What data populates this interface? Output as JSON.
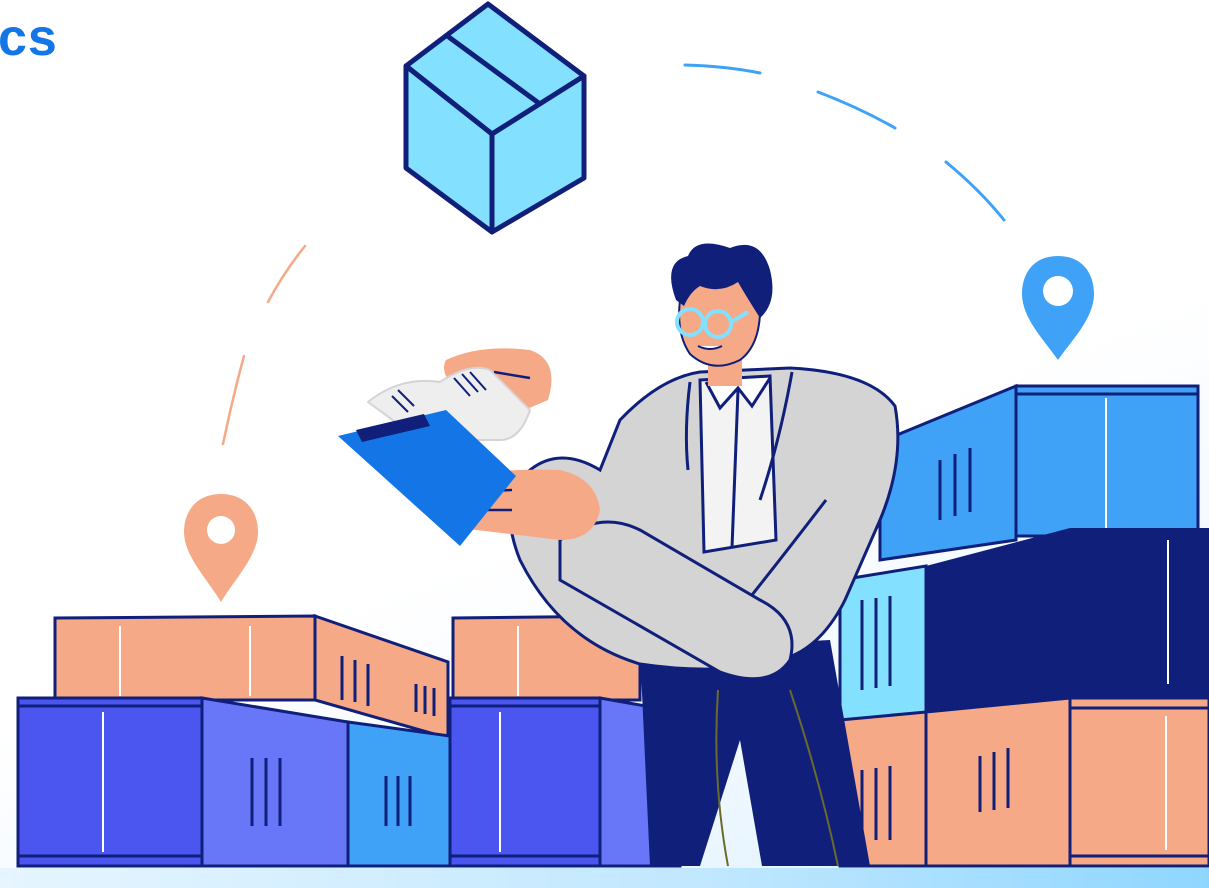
{
  "title_fragment": "cs",
  "colors": {
    "accent": "#1476e6",
    "navy": "#0f1f7a",
    "peach": "#f5a987",
    "sky": "#84e0ff",
    "blue": "#3fa2f7",
    "indigo": "#4b55f0",
    "periwinkle": "#6877f7",
    "grey": "#d4d4d4"
  },
  "icons": [
    "package-box-icon",
    "location-pin-icon"
  ]
}
